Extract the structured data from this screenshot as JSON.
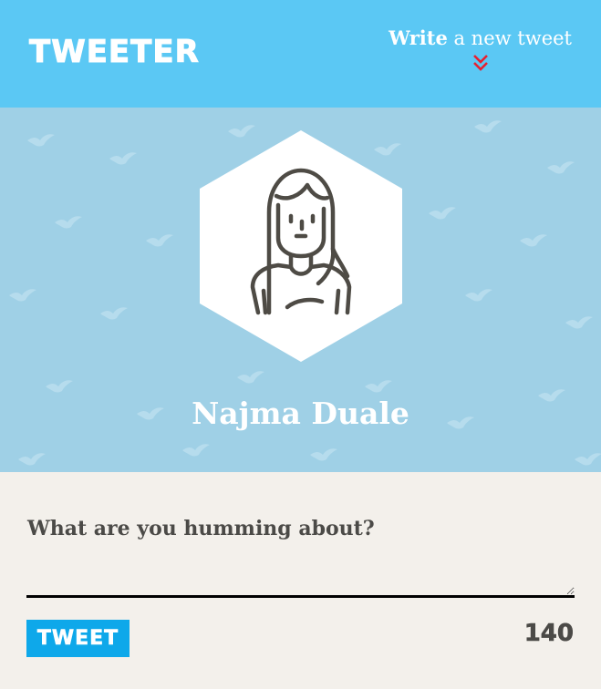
{
  "header": {
    "logo_text": "TWEETER",
    "write_link_bold": "Write",
    "write_link_rest": " a new tweet",
    "chevron_icon": "double-chevron-down-icon",
    "chevron_color": "#e8202f",
    "background_color": "#5bc8f4"
  },
  "profile": {
    "name": "Najma Duale",
    "avatar_icon": "woman-avatar-icon",
    "background_color": "#9fd0e6",
    "pattern_icon": "bird-icon"
  },
  "composer": {
    "prompt": "What are you humming about?",
    "input_value": "",
    "tweet_button_label": "TWEET",
    "char_count": "140",
    "button_color": "#0ea8ea"
  }
}
